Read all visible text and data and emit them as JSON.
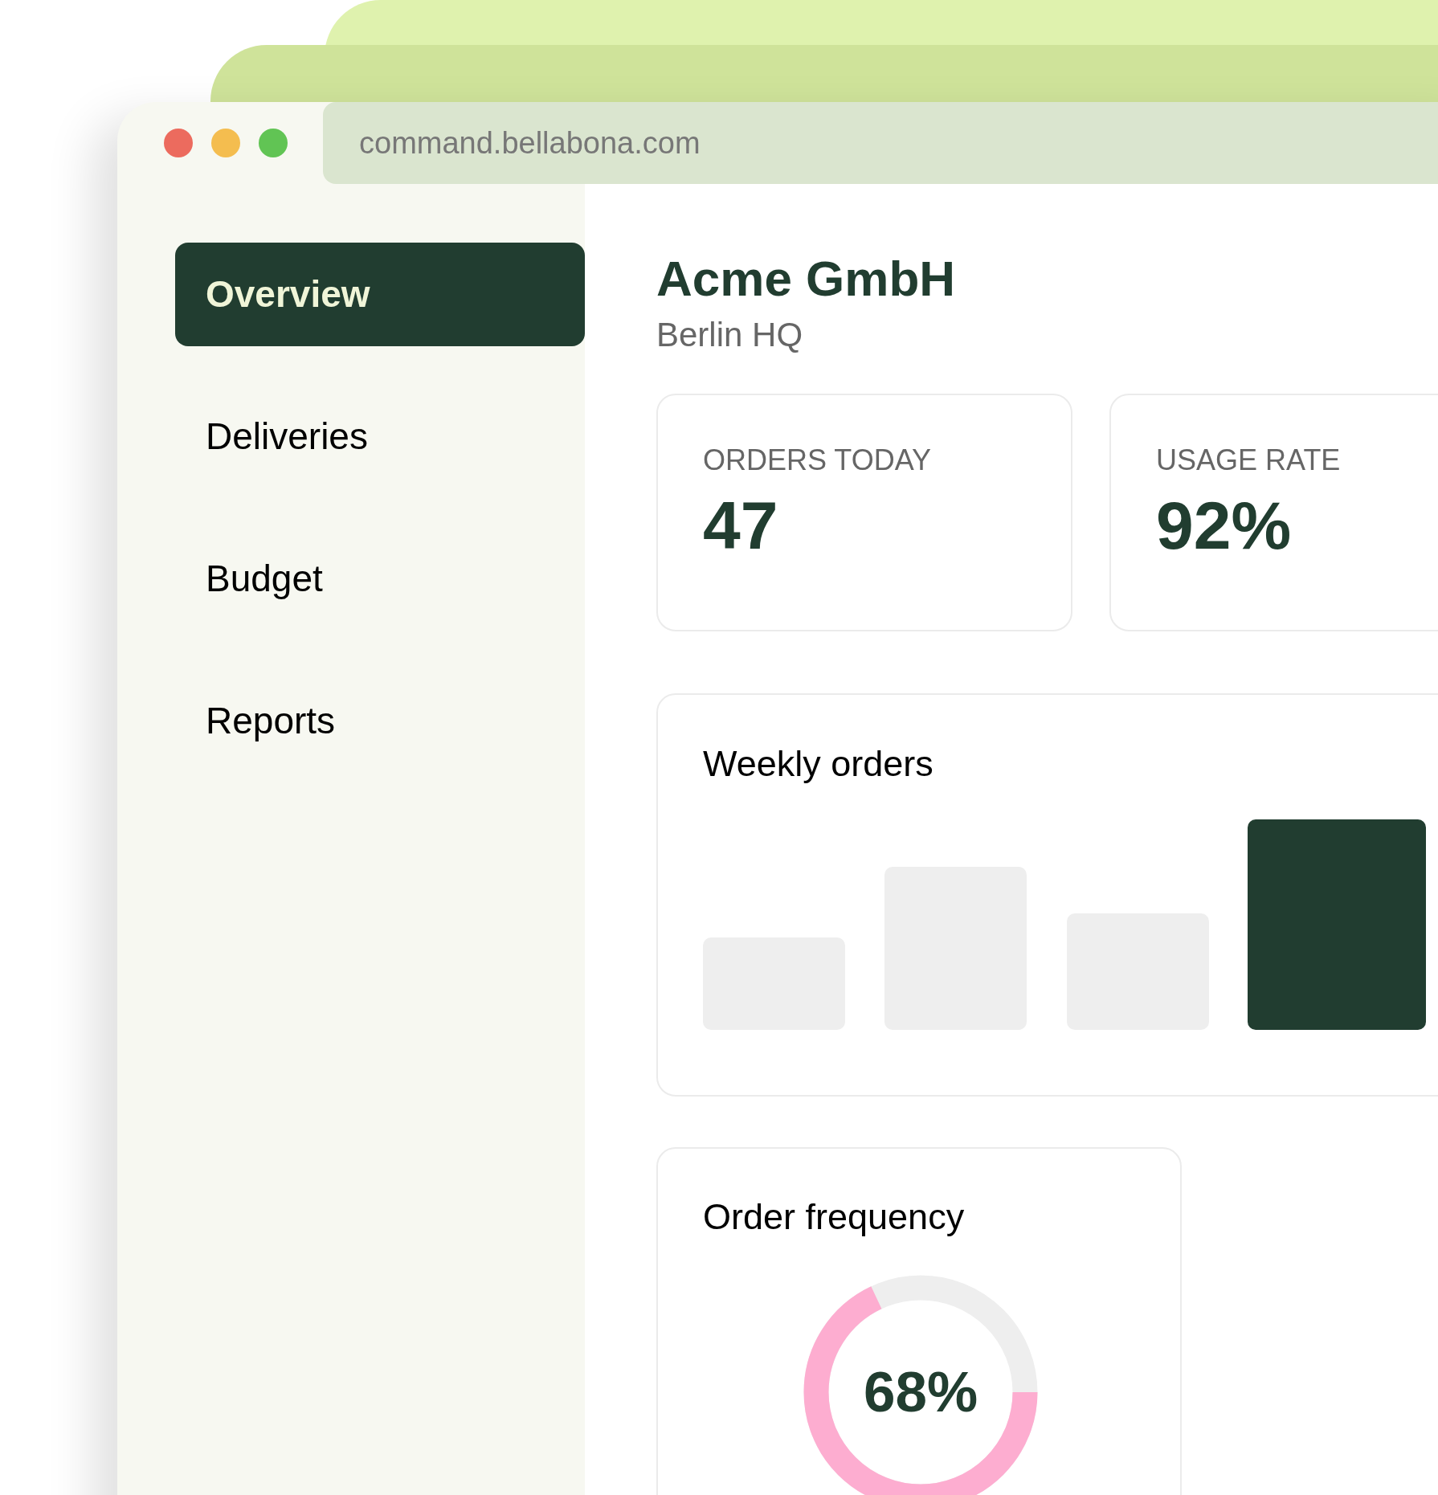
{
  "browser": {
    "url": "command.bellabona.com"
  },
  "sidebar": {
    "items": [
      {
        "label": "Overview",
        "selected": true
      },
      {
        "label": "Deliveries",
        "selected": false
      },
      {
        "label": "Budget",
        "selected": false
      },
      {
        "label": "Reports",
        "selected": false
      }
    ]
  },
  "header": {
    "title": "Acme GmbH",
    "subtitle": "Berlin HQ"
  },
  "stats": [
    {
      "label": "ORDERS TODAY",
      "value": "47"
    },
    {
      "label": "USAGE RATE",
      "value": "92%"
    }
  ],
  "weekly_orders": {
    "title": "Weekly orders"
  },
  "order_frequency": {
    "title": "Order frequency",
    "level": 0.68,
    "reading": "68%"
  }
}
